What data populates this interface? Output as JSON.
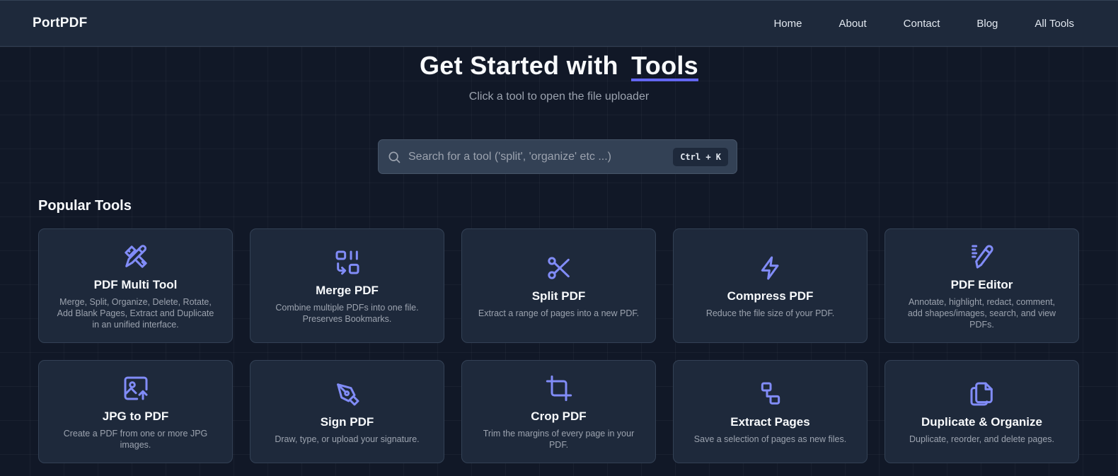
{
  "navbar": {
    "brand": "PortPDF",
    "links": [
      "Home",
      "About",
      "Contact",
      "Blog",
      "All Tools"
    ]
  },
  "hero": {
    "title_prefix": "Get Started with",
    "title_accent": "Tools",
    "subtitle": "Click a tool to open the file uploader"
  },
  "search": {
    "placeholder": "Search for a tool ('split', 'organize' etc ...)",
    "shortcut": "Ctrl + K"
  },
  "section": {
    "title": "Popular Tools"
  },
  "tools": [
    {
      "icon": "pencil-ruler-icon",
      "title": "PDF Multi Tool",
      "desc": "Merge, Split, Organize, Delete, Rotate, Add Blank Pages, Extract and Duplicate in an unified interface."
    },
    {
      "icon": "merge-pages-icon",
      "title": "Merge PDF",
      "desc": "Combine multiple PDFs into one file. Preserves Bookmarks."
    },
    {
      "icon": "scissors-icon",
      "title": "Split PDF",
      "desc": "Extract a range of pages into a new PDF."
    },
    {
      "icon": "lightning-bolt-icon",
      "title": "Compress PDF",
      "desc": "Reduce the file size of your PDF."
    },
    {
      "icon": "pen-tool-icon",
      "title": "PDF Editor",
      "desc": "Annotate, highlight, redact, comment, add shapes/images, search, and view PDFs."
    },
    {
      "icon": "image-upload-icon",
      "title": "JPG to PDF",
      "desc": "Create a PDF from one or more JPG images."
    },
    {
      "icon": "signature-pen-icon",
      "title": "Sign PDF",
      "desc": "Draw, type, or upload your signature."
    },
    {
      "icon": "crop-icon",
      "title": "Crop PDF",
      "desc": "Trim the margins of every page in your PDF."
    },
    {
      "icon": "extract-pages-icon",
      "title": "Extract Pages",
      "desc": "Save a selection of pages as new files."
    },
    {
      "icon": "copy-pages-icon",
      "title": "Duplicate & Organize",
      "desc": "Duplicate, reorder, and delete pages."
    }
  ],
  "colors": {
    "accent": "#6366f1",
    "icon": "#818cf8",
    "card_bg": "#1e293b",
    "page_bg": "#111827"
  }
}
